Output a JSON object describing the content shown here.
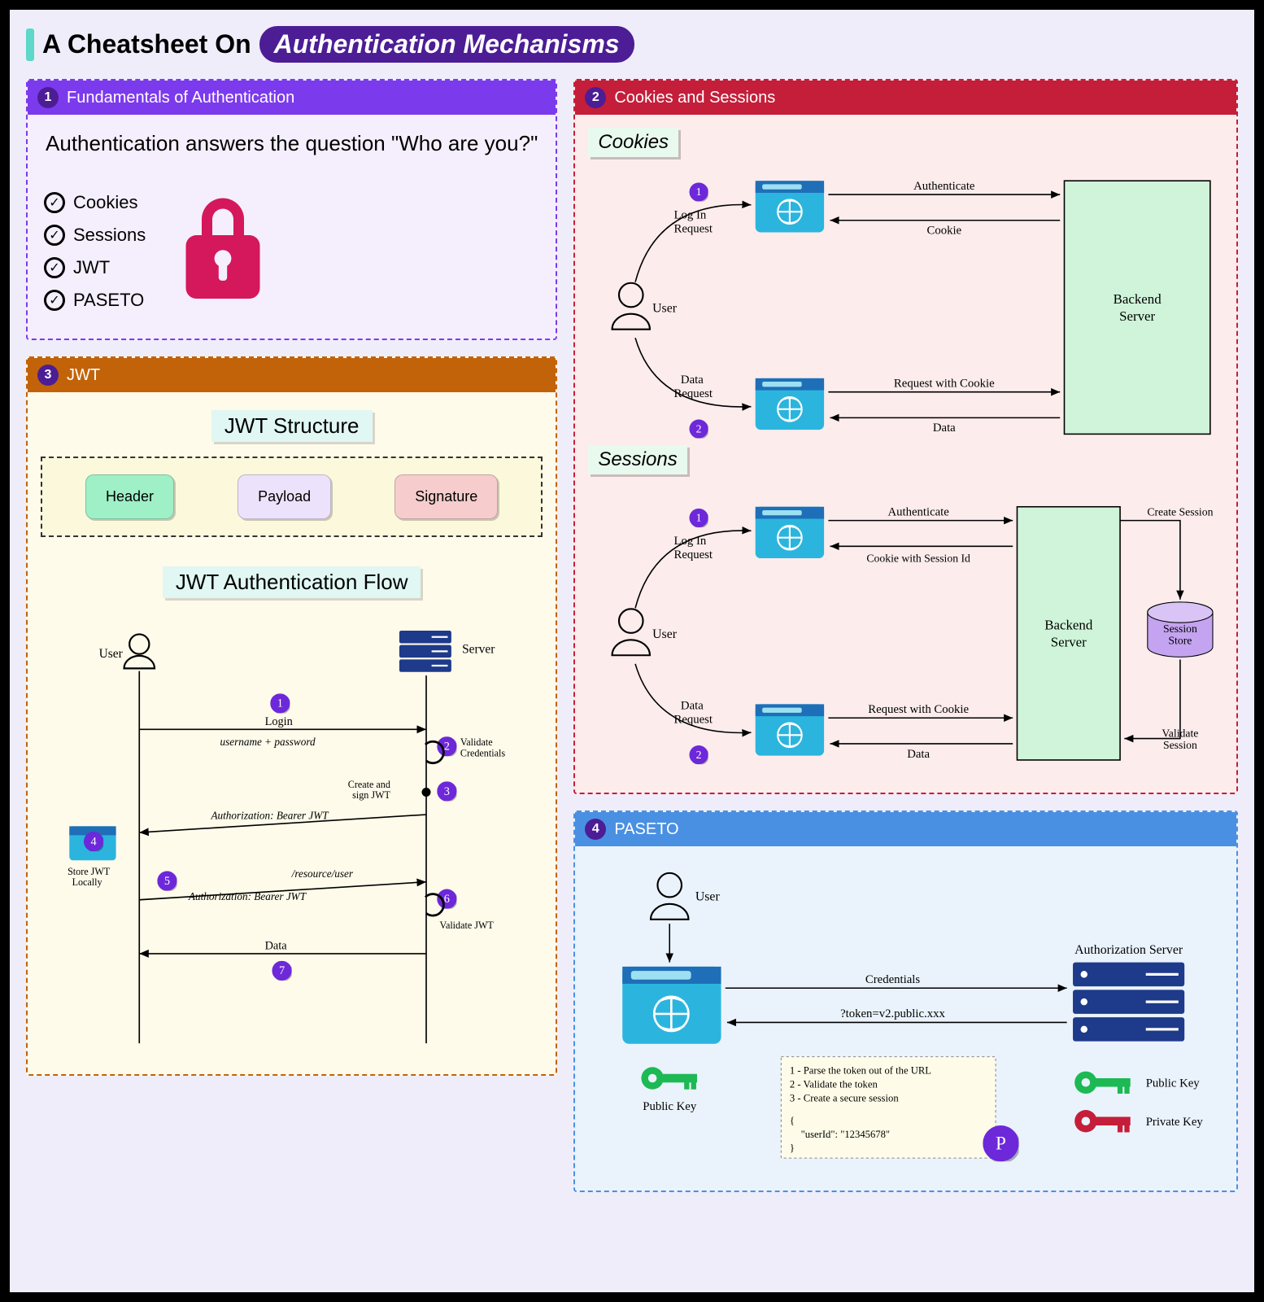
{
  "title": {
    "pre": "A Cheatsheet On",
    "highlight": "Authentication Mechanisms"
  },
  "panels": {
    "p1": {
      "num": "1",
      "header": "Fundamentals of Authentication",
      "question": "Authentication answers the question \"Who are you?\"",
      "items": [
        "Cookies",
        "Sessions",
        "JWT",
        "PASETO"
      ]
    },
    "p2": {
      "num": "2",
      "header": "Cookies and Sessions",
      "sub1": "Cookies",
      "sub2": "Sessions",
      "cookies": {
        "user": "User",
        "login_request": "Log In Request",
        "data_request": "Data Request",
        "authenticate": "Authenticate",
        "cookie": "Cookie",
        "request_with_cookie": "Request with Cookie",
        "data": "Data",
        "backend": "Backend Server",
        "s1": "1",
        "s2": "2"
      },
      "sessions": {
        "user": "User",
        "login_request": "Log In Request",
        "data_request": "Data Request",
        "authenticate": "Authenticate",
        "cookie_session": "Cookie with Session Id",
        "request_with_cookie": "Request with Cookie",
        "data": "Data",
        "backend": "Backend Server",
        "create_session": "Create Session",
        "validate_session": "Validate Session",
        "store": "Session Store",
        "s1": "1",
        "s2": "2"
      }
    },
    "p3": {
      "num": "3",
      "header": "JWT",
      "structure_title": "JWT Structure",
      "parts": {
        "h": "Header",
        "p": "Payload",
        "s": "Signature"
      },
      "flow_title": "JWT Authentication Flow",
      "flow": {
        "user": "User",
        "server": "Server",
        "login": "Login",
        "cred": "username + password",
        "validate_cred": "Validate Credentials",
        "create_sign": "Create and sign JWT",
        "bearer": "Authorization: Bearer JWT",
        "store_local": "Store JWT Locally",
        "resource": "/resource/user",
        "bearer2": "Authorization: Bearer JWT",
        "validate_jwt": "Validate JWT",
        "data": "Data",
        "s1": "1",
        "s2": "2",
        "s3": "3",
        "s4": "4",
        "s5": "5",
        "s6": "6",
        "s7": "7"
      }
    },
    "p4": {
      "num": "4",
      "header": "PASETO",
      "user": "User",
      "authserver": "Authorization Server",
      "credentials": "Credentials",
      "token": "?token=v2.public.xxx",
      "public_key": "Public Key",
      "private_key": "Private Key",
      "steps": "1 - Parse the token out of the URL\n2 - Validate the token\n3 - Create a secure session",
      "json": "{\n  \"userId\": \"12345678\"\n}",
      "p_label": "P"
    }
  }
}
